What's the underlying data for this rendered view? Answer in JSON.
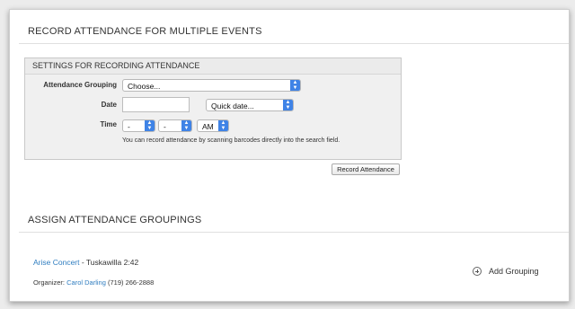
{
  "page": {
    "title": "RECORD ATTENDANCE FOR MULTIPLE EVENTS"
  },
  "settings": {
    "header": "SETTINGS FOR RECORDING ATTENDANCE",
    "grouping_label": "Attendance Grouping",
    "grouping_value": "Choose...",
    "date_label": "Date",
    "date_value": "",
    "quick_date_value": "Quick date...",
    "time_label": "Time",
    "hour_value": "-",
    "minute_value": "-",
    "ampm_value": "AM",
    "hint": "You can record attendance by scanning barcodes directly into the search field."
  },
  "record_button": "Record Attendance",
  "assign": {
    "title": "ASSIGN ATTENDANCE GROUPINGS",
    "event_link": "Arise Concert",
    "event_detail": " - Tuskawilla 2:42",
    "organizer_label": "Organizer: ",
    "organizer_name": "Carol Darling",
    "organizer_phone": " (719) 266-2888",
    "add_grouping": "Add Grouping"
  },
  "colors": {
    "link": "#2f7dc0",
    "select_arrow": "#3f83e6"
  },
  "icons": {
    "add": "circle-plus-icon",
    "select": "up-down-chevron-icon"
  }
}
